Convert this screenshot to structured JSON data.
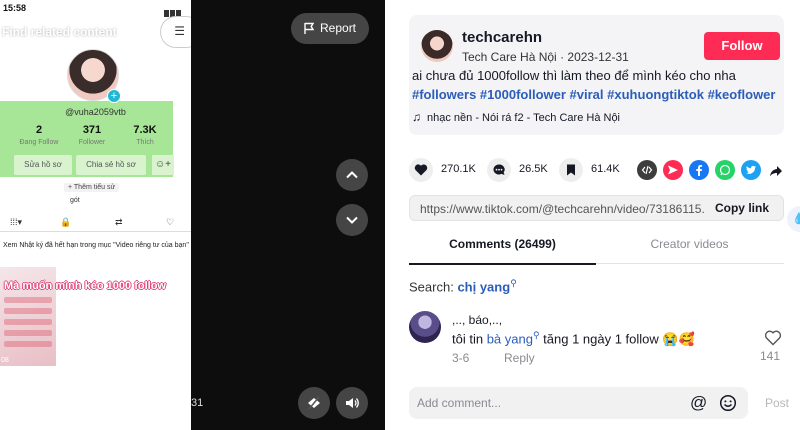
{
  "video": {
    "phone": {
      "status_time": "15:58",
      "find_related": "Find related content",
      "handle": "@vuha2059vtb",
      "stats": [
        {
          "value": "2",
          "label": "Đang Follow"
        },
        {
          "value": "371",
          "label": "Follower"
        },
        {
          "value": "7.3K",
          "label": "Thích"
        }
      ],
      "edit_profile": "Sửa hồ sơ",
      "share_profile": "Chia sẻ hồ sơ",
      "add_bio": "+ Thêm tiểu sử",
      "bio_line": "gót",
      "notice": "Xem Nhật ký đã hết hạn trong mục \"Video riêng tư của bạn\"",
      "thumb_overlay": "Mà muốn mình kéo 1000 follow",
      "thumb_count": "08"
    },
    "time": "31",
    "report_label": "Report"
  },
  "author": {
    "username": "techcarehn",
    "nickname": "Tech Care Hà Nội",
    "separator": "·",
    "date": "2023-12-31",
    "follow_label": "Follow"
  },
  "post": {
    "text": "ai chưa đủ 1000follow thì làm theo để mình kéo cho nha",
    "hashtags": [
      "#followers",
      "#1000follower",
      "#viral",
      "#xuhuongtiktok",
      "#keoflower"
    ],
    "music": "nhạc nền - Nói rá f2 - Tech Care Hà Nội"
  },
  "actions": {
    "likes": "270.1K",
    "comments": "26.5K",
    "saves": "61.4K"
  },
  "share_colors": {
    "embed": "#3d3d3d",
    "send": "#fe2c55",
    "facebook": "#1877f2",
    "whatsapp": "#25d366",
    "twitter": "#1da1f2"
  },
  "link": {
    "url": "https://www.tiktok.com/@techcarehn/video/73186115...",
    "copy_label": "Copy link"
  },
  "tabs": {
    "comments": "Comments (26499)",
    "creator_videos": "Creator videos"
  },
  "search": {
    "label": "Search:",
    "query": "chị yang"
  },
  "comment": {
    "author": ",.., báo,..,",
    "text_before": "tôi tin ",
    "mention": "bà yang",
    "text_after": " tăng 1 ngày 1 follow 😭🥰",
    "date": "3-6",
    "reply_label": "Reply",
    "likes": "141"
  },
  "composer": {
    "placeholder": "Add comment...",
    "post_label": "Post"
  }
}
